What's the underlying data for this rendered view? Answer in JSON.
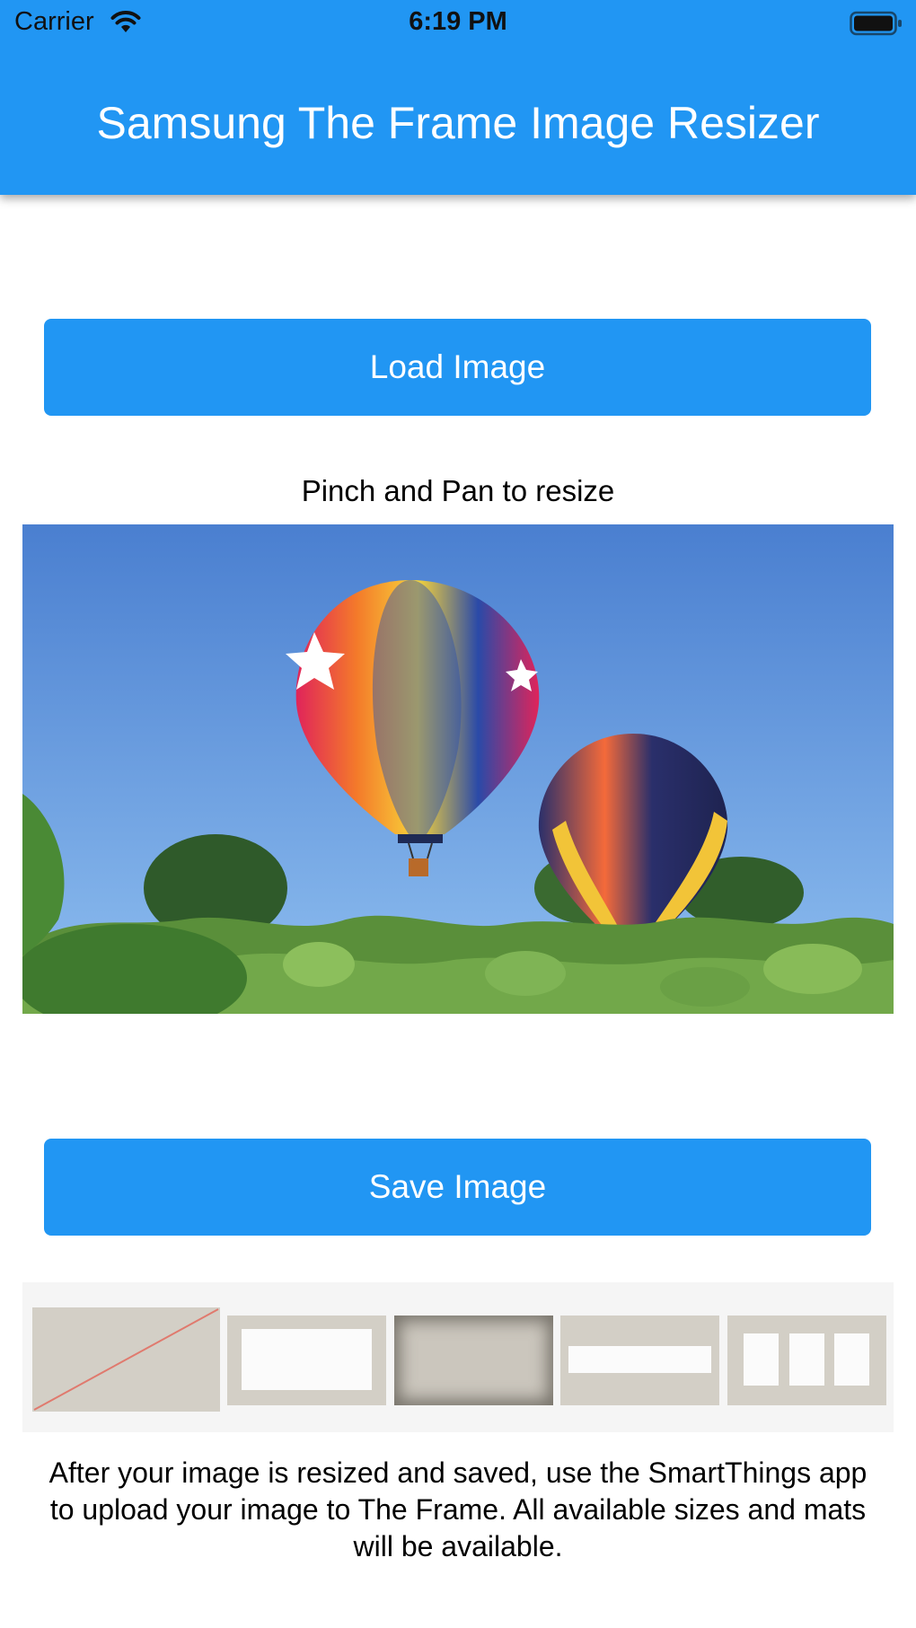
{
  "status_bar": {
    "carrier": "Carrier",
    "time": "6:19 PM",
    "wifi_icon": "wifi-icon",
    "battery_icon": "battery-icon"
  },
  "header": {
    "title": "Samsung The Frame Image Resizer",
    "color": "#2196f3"
  },
  "load_button": {
    "label": "Load Image"
  },
  "hint": {
    "text": "Pinch and Pan to resize"
  },
  "preview": {
    "description_icon": "photo-hot-air-balloons"
  },
  "save_button": {
    "label": "Save Image"
  },
  "mats": {
    "items": [
      {
        "name": "none",
        "selected": true
      },
      {
        "name": "wide",
        "selected": false
      },
      {
        "name": "shadowbox",
        "selected": false
      },
      {
        "name": "panorama",
        "selected": false
      },
      {
        "name": "triptych",
        "selected": false
      }
    ]
  },
  "footer": {
    "text": "After your image is resized and saved, use the SmartThings app to upload your image to The Frame. All available sizes and mats will be available."
  },
  "colors": {
    "accent": "#2196f3",
    "mat": "#d3cfc6",
    "no_mat_line": "#e07a6e"
  }
}
